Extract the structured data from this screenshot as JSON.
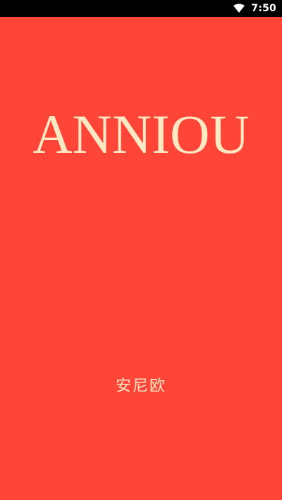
{
  "status_bar": {
    "time": "7:50",
    "icons": [
      "wifi-icon"
    ]
  },
  "splash": {
    "logo_text": "ANNIOU",
    "subtitle": "安尼欧"
  },
  "colors": {
    "background": "#ff4438",
    "text": "#fce9c4",
    "status_bar": "#000000"
  }
}
